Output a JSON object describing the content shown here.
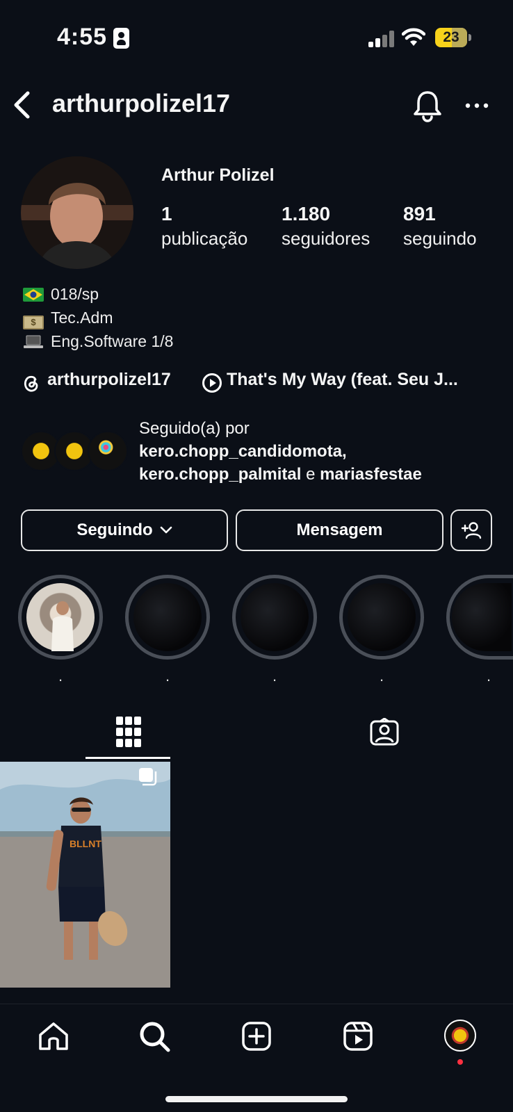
{
  "status_bar": {
    "time": "4:55",
    "battery": "23",
    "battery_color": "#f7d21b"
  },
  "header": {
    "username": "arthurpolizel17",
    "back_icon": "chevron-left-icon",
    "bell_icon": "bell-icon",
    "more_icon": "more-horizontal-icon"
  },
  "profile": {
    "full_name": "Arthur Polizel",
    "stats": [
      {
        "value": "1",
        "label": "publicação"
      },
      {
        "value": "1.180",
        "label": "seguidores"
      },
      {
        "value": "891",
        "label": "seguindo"
      }
    ],
    "bio": [
      {
        "icon": "brazil-flag-icon",
        "text": "018/sp"
      },
      {
        "icon": "money-icon",
        "text": "Tec.Adm"
      },
      {
        "icon": "laptop-icon",
        "text": "Eng.Software 1/8"
      }
    ],
    "threads_handle": "arthurpolizel17",
    "music": "That's My Way (feat. Seu J..."
  },
  "followed_by": {
    "prefix": "Seguido(a) por",
    "user1": "kero.chopp_candidomota,",
    "user2": "kero.chopp_palmital",
    "connector": "e",
    "user3": "mariasfestae"
  },
  "actions": {
    "following": "Seguindo",
    "message": "Mensagem"
  },
  "highlights": [
    {
      "label": "."
    },
    {
      "label": "."
    },
    {
      "label": "."
    },
    {
      "label": "."
    },
    {
      "label": "."
    }
  ],
  "tabs": {
    "grid_icon": "grid-icon",
    "tagged_icon": "tagged-person-icon"
  },
  "bottom_nav": [
    "home-icon",
    "search-icon",
    "create-icon",
    "reels-icon",
    "profile-avatar"
  ],
  "accent_red": "#ff3040"
}
